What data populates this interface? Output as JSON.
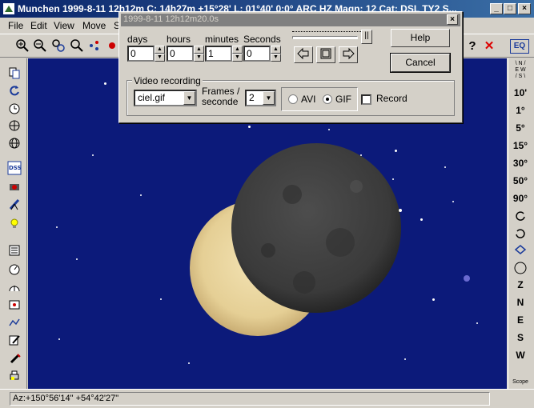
{
  "window": {
    "title": "Munchen 1999-8-11 12h12m C: 14h27m +15°28' L: 01°40' 0:0° ARC HZ  Magn: 12 Cat: DSL TY2 S...",
    "buttons": {
      "minimize": "_",
      "maximize": "□",
      "close": "×"
    }
  },
  "menu": [
    "File",
    "Edit",
    "View",
    "Move",
    "S"
  ],
  "toolbar": {
    "icons": [
      "zoom-in-icon",
      "zoom-out-icon",
      "zoom-tool-icon",
      "search-icon",
      "projection-icon",
      "sun-icon"
    ],
    "right_buttons": {
      "help": "?",
      "close": "✕",
      "eq": "EQ"
    }
  },
  "right_toolbar": {
    "labels": [
      "10'",
      "1°",
      "5°",
      "15°",
      "30°",
      "50°",
      "90°",
      "Z",
      "N",
      "E",
      "S",
      "W"
    ],
    "scope": "Scope"
  },
  "status": {
    "coords": "Az:+150°56'14\" +54°42'27\""
  },
  "dialog": {
    "title": "1999-8-11  12h12m20.0s",
    "close": "×",
    "fields": [
      {
        "label": "days",
        "value": "0"
      },
      {
        "label": "hours",
        "value": "0"
      },
      {
        "label": "minutes",
        "value": "1"
      },
      {
        "label": "Seconds",
        "value": "0"
      }
    ],
    "slider_position": 0.97,
    "buttons": {
      "help": "Help",
      "cancel": "Cancel"
    },
    "video": {
      "group_label": "Video recording",
      "file": "ciel.gif",
      "frames_label": "Frames / seconde",
      "frames_value": "2",
      "format_avi": "AVI",
      "format_gif": "GIF",
      "selected_format": "GIF",
      "record_label": "Record",
      "record_checked": false
    }
  },
  "colors": {
    "sky": "#0c1a7a",
    "sun": "#e9d5a0",
    "moon": "#3c3c3c",
    "titlebar": "#0a246a"
  }
}
